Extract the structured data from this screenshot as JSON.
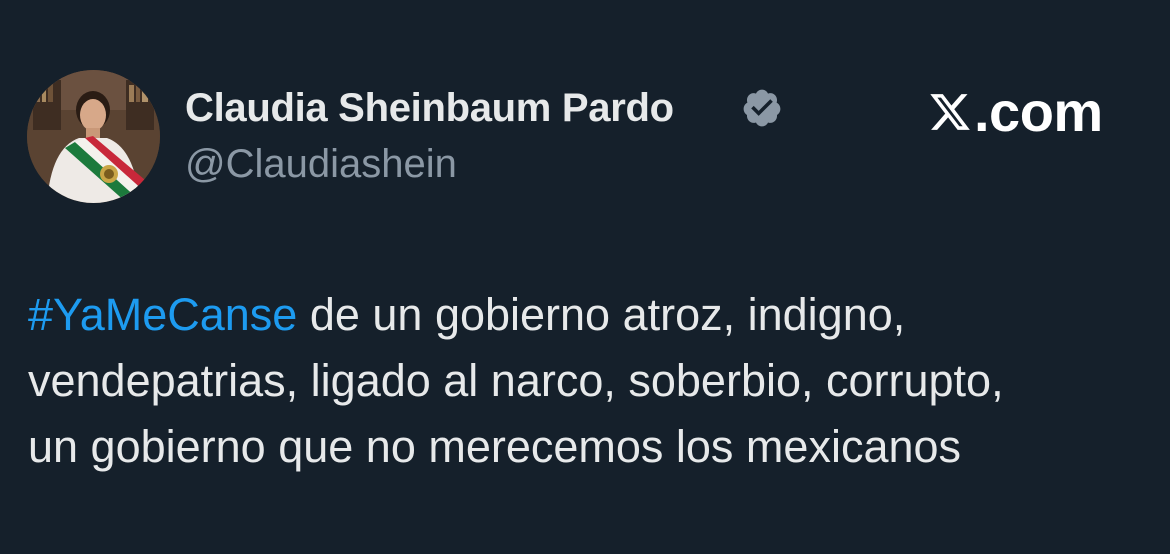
{
  "author": {
    "display_name": "Claudia Sheinbaum Pardo",
    "handle": "@Claudiashein",
    "verified": true,
    "verified_badge_color": "#8b98a5",
    "avatar_icon": "profile-photo"
  },
  "brand": {
    "text": ".com",
    "icon": "x-logo-icon"
  },
  "tweet": {
    "hashtag": "#YaMeCanse",
    "line1_rest": " de un gobierno atroz, indigno,",
    "line2": "vendepatrias, ligado al narco, soberbio, corrupto,",
    "line3": "un gobierno que no merecemos los mexicanos"
  },
  "colors": {
    "background": "#15202b",
    "text_primary": "#e7e9ea",
    "text_secondary": "#8b98a5",
    "hashtag": "#1d9bf0"
  }
}
